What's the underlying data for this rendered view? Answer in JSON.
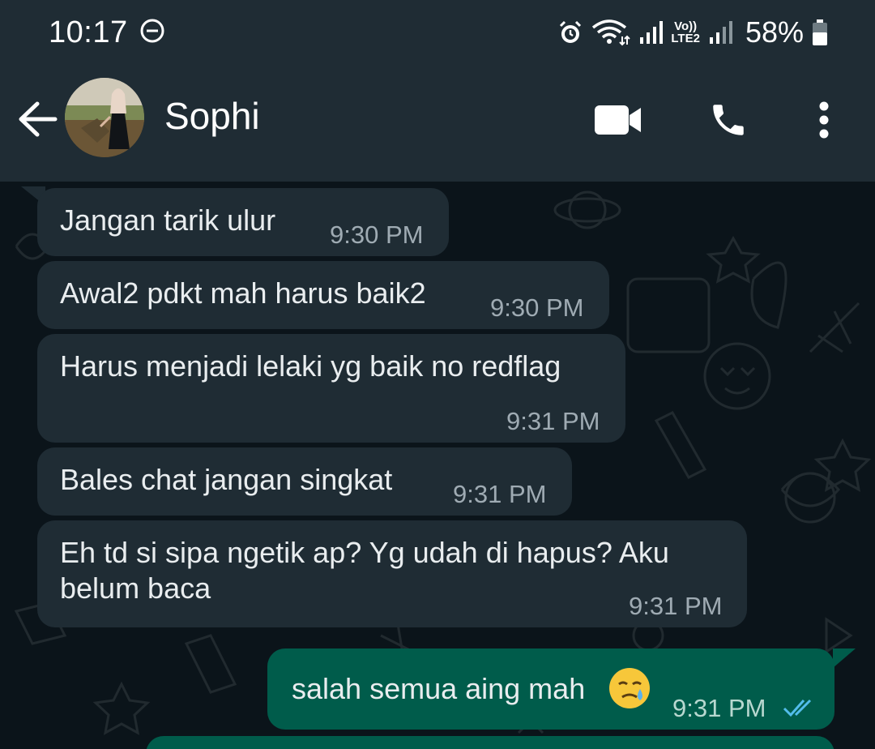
{
  "status_bar": {
    "time": "10:17",
    "volte_line1": "Vo))",
    "volte_line2": "LTE2",
    "battery": "58%",
    "icons": [
      "dnd-icon",
      "alarm-icon",
      "wifi-icon",
      "signal-icon",
      "volte-icon",
      "signal-icon",
      "battery-icon"
    ]
  },
  "header": {
    "contact_name": "Sophi",
    "icons": [
      "back-arrow-icon",
      "video-call-icon",
      "phone-icon",
      "more-vert-icon"
    ]
  },
  "messages": [
    {
      "direction": "in",
      "text": "Jangan tarik ulur",
      "time": "9:30 PM"
    },
    {
      "direction": "in",
      "text": "Awal2 pdkt mah harus baik2",
      "time": "9:30 PM"
    },
    {
      "direction": "in",
      "text": "Harus menjadi lelaki yg baik no redflag",
      "time": "9:31 PM"
    },
    {
      "direction": "in",
      "text": "Bales chat jangan singkat",
      "time": "9:31 PM"
    },
    {
      "direction": "in",
      "text_line1": "Eh td si sipa ngetik ap? Yg udah di hapus? Aku",
      "text_line2": "belum baca",
      "time": "9:31 PM"
    },
    {
      "direction": "out",
      "text": "salah semua aing mah",
      "emoji": "face-holding-back-tears",
      "time": "9:31 PM",
      "status": "read"
    }
  ],
  "colors": {
    "header_bg": "#1f2c34",
    "chat_bg": "#0b141a",
    "incoming_bubble": "#1f2c34",
    "outgoing_bubble": "#005c4b",
    "read_ticks": "#53bdeb"
  }
}
